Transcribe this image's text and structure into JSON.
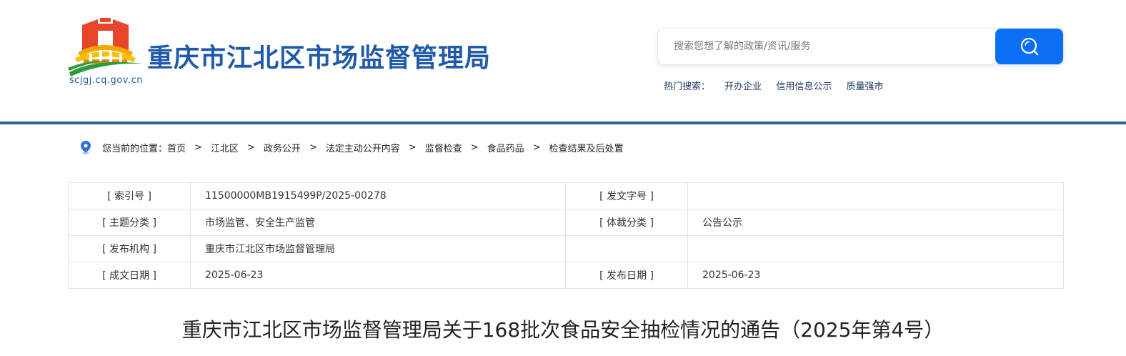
{
  "header": {
    "site_title": "重庆市江北区市场监督管理局",
    "domain": "scjgj.cq.gov.cn",
    "logo_icon": "emblem-logo-icon"
  },
  "search": {
    "placeholder": "搜索您想了解的政策/资讯/服务",
    "button_icon": "search-icon",
    "button_color": "#0a6ff5"
  },
  "hot_search": {
    "label": "热门搜索：",
    "items": [
      "开办企业",
      "信用信息公示",
      "质量强市"
    ]
  },
  "breadcrumb": {
    "prefix": "您当前的位置：",
    "items": [
      "首页",
      "江北区",
      "政务公开",
      "法定主动公开内容",
      "监督检查",
      "食品药品",
      "检查结果及后处置"
    ],
    "separator": ">"
  },
  "meta_table": {
    "rows": [
      {
        "k1": "[ 索引号 ]",
        "v1": "11500000MB1915499P/2025-00278",
        "k2": "[ 发文字号 ]",
        "v2": ""
      },
      {
        "k1": "[ 主题分类 ]",
        "v1": "市场监管、安全生产监管",
        "k2": "[ 体裁分类 ]",
        "v2": "公告公示"
      },
      {
        "k1": "[ 发布机构 ]",
        "v1": "重庆市江北区市场监督管理局",
        "k2": "",
        "v2": ""
      },
      {
        "k1": "[ 成文日期 ]",
        "v1": "2025-06-23",
        "k2": "[ 发布日期 ]",
        "v2": "2025-06-23"
      }
    ]
  },
  "document": {
    "title": "重庆市江北区市场监督管理局关于168批次食品安全抽检情况的通告（2025年第4号）"
  },
  "colors": {
    "brand_blue": "#1f59a8",
    "divider": "#2f5fa3"
  }
}
